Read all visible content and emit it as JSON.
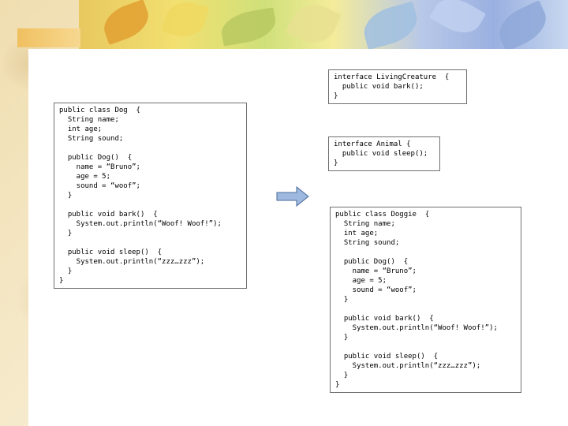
{
  "dog_box": {
    "lines": [
      "public class Dog  {",
      "  String name;",
      "  int age;",
      "  String sound;",
      "",
      "  public Dog()  {",
      "    name = “Bruno”;",
      "    age = 5;",
      "    sound = “woof”;",
      "  }",
      "",
      "  public void bark()  {",
      "    System.out.println(“Woof! Woof!”);",
      "  }",
      "",
      "  public void sleep()  {",
      "    System.out.println(“zzz…zzz”);",
      "  }",
      "}"
    ]
  },
  "living_creature_box": {
    "lines": [
      "interface LivingCreature  {",
      "  public void bark();",
      "}"
    ]
  },
  "animal_box": {
    "lines": [
      "interface Animal {",
      "  public void sleep();",
      "}"
    ]
  },
  "doggie_box": {
    "lines": [
      "public class Doggie  {",
      "  String name;",
      "  int age;",
      "  String sound;",
      "",
      "  public Dog()  {",
      "    name = “Bruno”;",
      "    age = 5;",
      "    sound = “woof”;",
      "  }",
      "",
      "  public void bark()  {",
      "    System.out.println(“Woof! Woof!”);",
      "  }",
      "",
      "  public void sleep()  {",
      "    System.out.println(“zzz…zzz”);",
      "  }",
      "}"
    ]
  },
  "colors": {
    "background": "#f3e7c4",
    "arrow_fill": "#9eb9e0",
    "arrow_stroke": "#4a6a9a",
    "box_border": "#6f6f6f"
  }
}
